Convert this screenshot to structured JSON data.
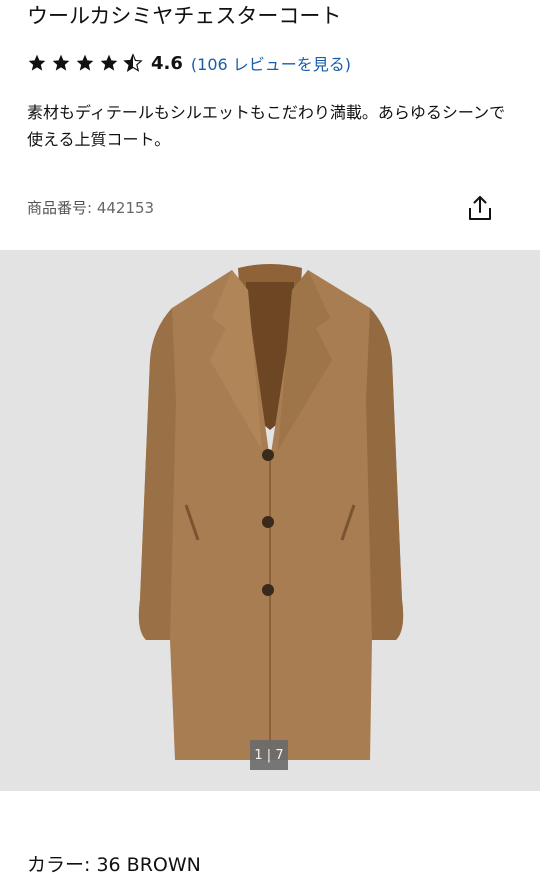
{
  "product": {
    "title": "ウールカシミヤチェスターコート",
    "rating": {
      "value": 4.6,
      "score_text": "4.6",
      "review_link": "(106 レビューを見る)"
    },
    "description": "素材もディテールもシルエットもこだわり満載。あらゆるシーンで使える上質コート。",
    "sku_label": "商品番号",
    "sku_value": ": 442153"
  },
  "icons": {
    "share": "share-icon",
    "stars": "star-icon"
  },
  "gallery": {
    "counter": "1 | 7",
    "background": "#e3e3e3",
    "coat_color": "#a87d52"
  },
  "color_selector": {
    "label": "カラー",
    "value": ": 36 BROWN"
  }
}
